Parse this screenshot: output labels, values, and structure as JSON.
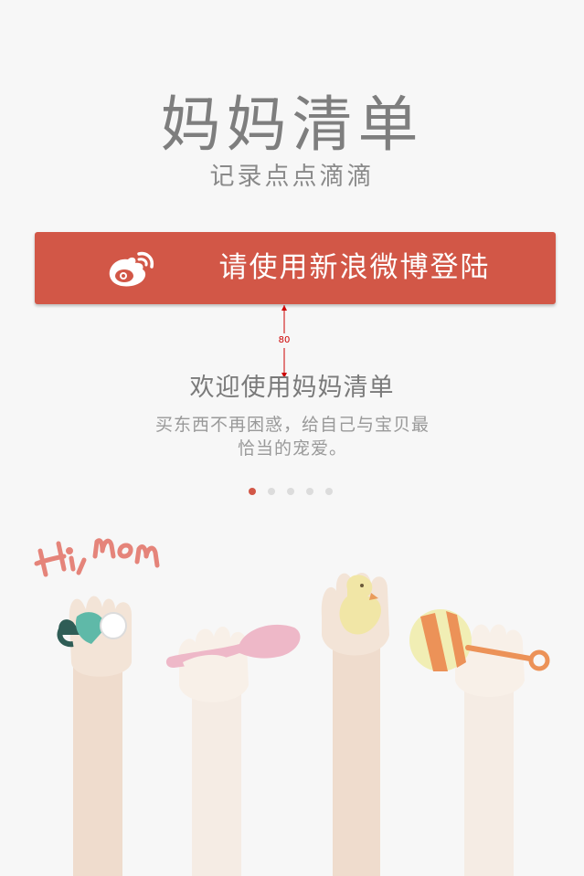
{
  "app": {
    "title": "妈妈清单",
    "subtitle": "记录点点滴滴"
  },
  "login": {
    "label": "请使用新浪微博登陆",
    "icon": "weibo-icon",
    "color": "#d25747"
  },
  "annotation": {
    "spacing_label": "80"
  },
  "welcome": {
    "title": "欢迎使用妈妈清单",
    "description_line1": "买东西不再困惑，给自己与宝贝最",
    "description_line2": "恰当的宠爱。"
  },
  "pager": {
    "count": 5,
    "active_index": 0,
    "active_color": "#d25747"
  },
  "illustration": {
    "greeting": "Hi,mom",
    "items": [
      "pacifier-icon",
      "spoon-icon",
      "rubber-duck-icon",
      "rattle-icon"
    ]
  }
}
